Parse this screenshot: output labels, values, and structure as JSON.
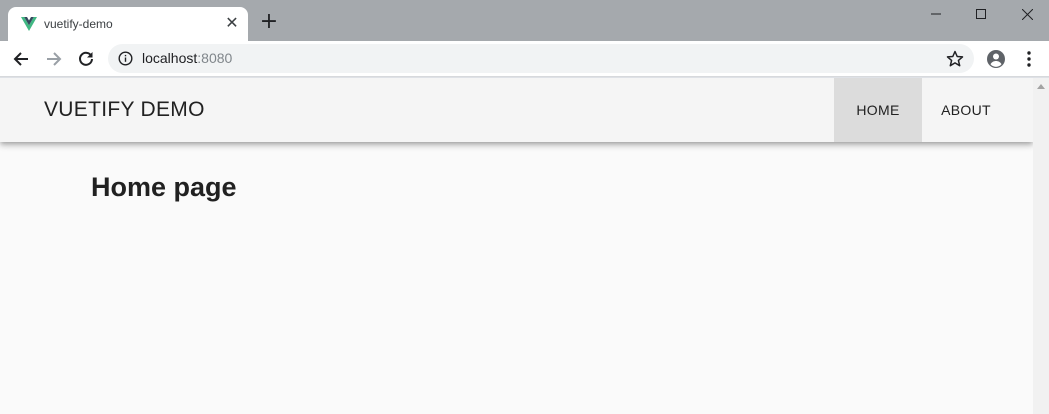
{
  "browser": {
    "tab": {
      "title": "vuetify-demo",
      "close_glyph": "✕",
      "favicon": "vue-logo-icon"
    },
    "new_tab_glyph": "+",
    "address_bar": {
      "host": "localhost",
      "port": ":8080"
    },
    "icons": [
      "back-arrow-icon",
      "forward-arrow-icon",
      "reload-icon",
      "info-icon",
      "star-icon",
      "profile-icon",
      "menu-icon",
      "minimize-icon",
      "maximize-icon",
      "close-icon"
    ]
  },
  "app": {
    "title": "VUETIFY DEMO",
    "nav": [
      {
        "label": "HOME",
        "active": true
      },
      {
        "label": "ABOUT",
        "active": false
      }
    ],
    "heading": "Home page"
  },
  "colors": {
    "tabstrip": "#a5a9ad",
    "app_bar": "#f5f5f5",
    "active_nav": "#dcdcdc",
    "vue_green": "#41b883",
    "vue_dark": "#35495e"
  }
}
